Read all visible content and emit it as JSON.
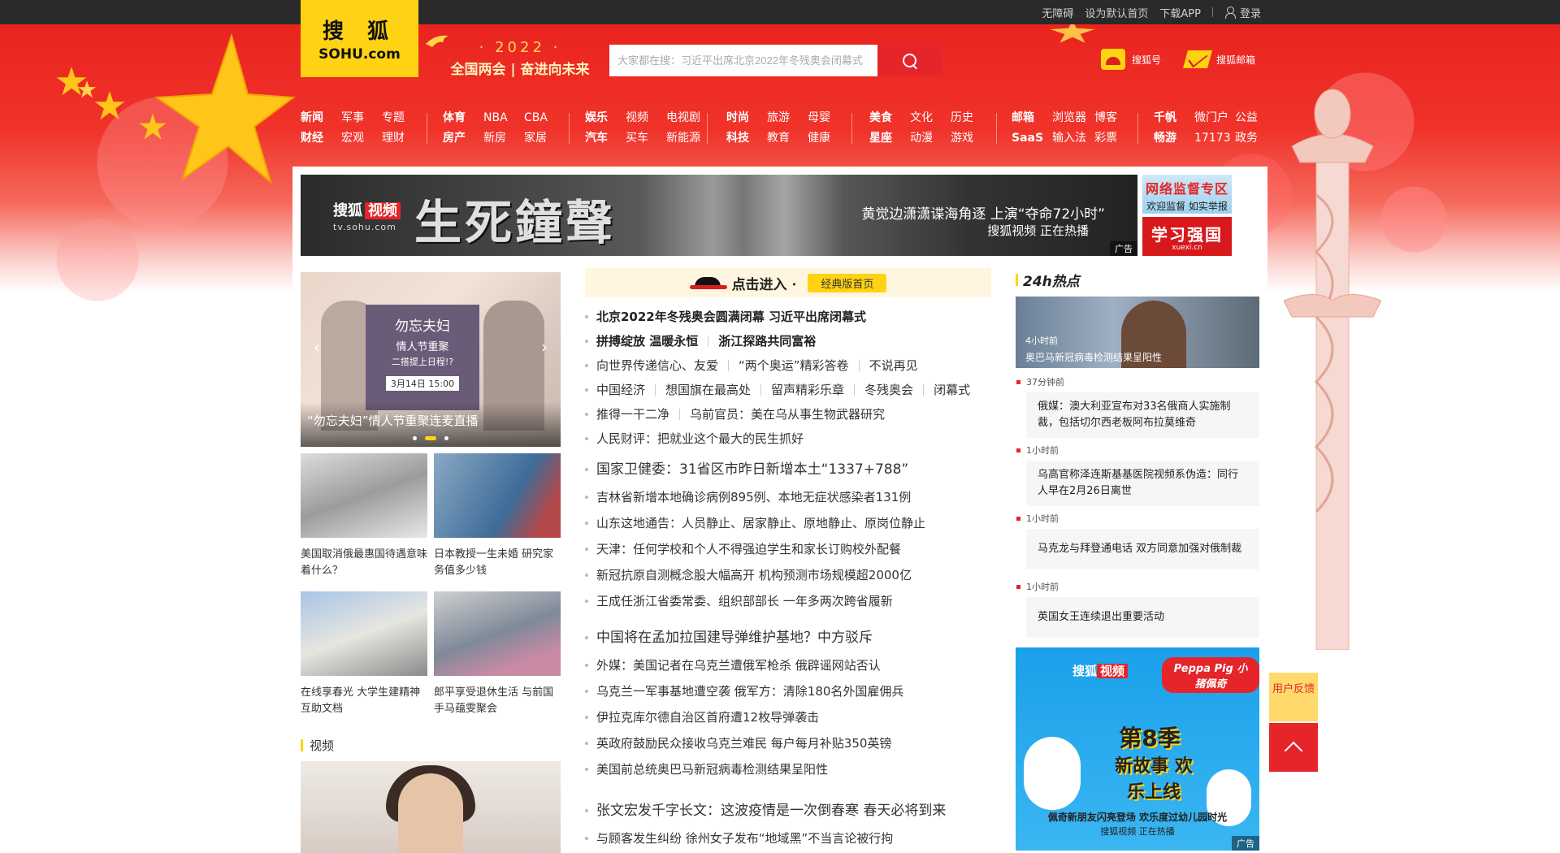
{
  "topbar": {
    "accessibility": "无障碍",
    "set_home": "设为默认首页",
    "download_app": "下载APP",
    "login": "登录"
  },
  "logo": {
    "cn": "搜 狐",
    "en": "SOHU.com"
  },
  "slogan": {
    "year": "· 2022 ·",
    "text": "全国两会 | 奋进向未来"
  },
  "search": {
    "placeholder": "大家都在搜：习近平出席北京2022年冬残奥会闭幕式"
  },
  "header_links": {
    "hao": "搜狐号",
    "mail": "搜狐邮箱"
  },
  "nav": [
    [
      "新闻",
      "军事",
      "专题",
      "财经",
      "宏观",
      "理财"
    ],
    [
      "体育",
      "NBA",
      "CBA",
      "房产",
      "新房",
      "家居"
    ],
    [
      "娱乐",
      "视频",
      "电视剧",
      "汽车",
      "买车",
      "新能源"
    ],
    [
      "时尚",
      "旅游",
      "母婴",
      "科技",
      "教育",
      "健康"
    ],
    [
      "美食",
      "文化",
      "历史",
      "星座",
      "动漫",
      "游戏"
    ],
    [
      "邮箱",
      "浏览器",
      "博客",
      "SaaS",
      "输入法",
      "彩票"
    ],
    [
      "千帆",
      "微门户",
      "公益",
      "畅游",
      "17173",
      "政务"
    ]
  ],
  "banner": {
    "brand_a": "搜狐",
    "brand_b": "视频",
    "url": "tv.sohu.com",
    "title": "生死鐘聲",
    "line1": "黄觉边潇潇谍海角逐  上演“夺命72小时”",
    "line2": "搜狐视频  正在热播",
    "ad": "广告"
  },
  "side_ads": {
    "a1_title": "网络监督专区",
    "a1_sub": "欢迎监督  如实举报",
    "a2_title": "学习强国",
    "a2_sub": "xuexi.cn"
  },
  "slider": {
    "poster_title": "勿忘夫妇",
    "poster_sub": "情人节重聚",
    "poster_line": "二搭提上日程!?",
    "poster_date": "3月14日 15:00",
    "caption": "“勿忘夫妇”情人节重聚连麦直播"
  },
  "pics": [
    {
      "caption": "美国取消俄最惠国待遇意味着什么？"
    },
    {
      "caption": "日本教授一生未婚 研究家务值多少钱"
    },
    {
      "caption": "在线享春光 大学生建精神互助文档"
    },
    {
      "caption": "郎平享受退休生活 与前国手马蕴雯聚会"
    }
  ],
  "video_section": {
    "title": "视频"
  },
  "classic": {
    "enter": "点击进入 ·",
    "button": "经典版首页"
  },
  "news_block1": {
    "row1": "北京2022年冬残奥会圆满闭幕 习近平出席闭幕式",
    "row2a": "拼搏绽放 温暖永恒",
    "row2b": "浙江探路共同富裕",
    "row3": [
      "向世界传递信心、友爱",
      "“两个奥运”精彩答卷",
      "不说再见"
    ],
    "row4": [
      "中国经济",
      "想国旗在最高处",
      "留声精彩乐章",
      "冬残奥会",
      "闭幕式"
    ],
    "row5": [
      "推得一干二净",
      "乌前官员：美在乌从事生物武器研究"
    ],
    "row6": "人民财评：把就业这个最大的民生抓好"
  },
  "news_block2": [
    "国家卫健委：31省区市昨日新增本土“1337+788”",
    "吉林省新增本地确诊病例895例、本地无症状感染者131例",
    "山东这地通告：人员静止、居家静止、原地静止、原岗位静止",
    "天津：任何学校和个人不得强迫学生和家长订购校外配餐",
    "新冠抗原自测概念股大幅高开 机构预测市场规模超2000亿",
    "王成任浙江省委常委、组织部部长 一年多两次跨省履新"
  ],
  "news_block3": [
    "中国将在孟加拉国建导弹维护基地？中方驳斥",
    "外媒：美国记者在乌克兰遭俄军枪杀 俄辟谣网站否认",
    "乌克兰一军事基地遭空袭 俄军方：清除180名外国雇佣兵",
    "伊拉克库尔德自治区首府遭12枚导弹袭击",
    "英政府鼓励民众接收乌克兰难民 每户每月补贴350英镑",
    "美国前总统奥巴马新冠病毒检测结果呈阳性"
  ],
  "news_block4": [
    "张文宏发千字长文：这波疫情是一次倒春寒 春天必将到来",
    "与顾客发生纠纷 徐州女子发布“地域黑”不当言论被行拘"
  ],
  "hot": {
    "title": "24h热点",
    "pic_time": "4小时前",
    "pic_text": "奥巴马新冠病毒检测结果呈阳性",
    "items": [
      {
        "time": "37分钟前",
        "text": "俄媒：澳大利亚宣布对33名俄商人实施制裁，包括切尔西老板阿布拉莫维奇"
      },
      {
        "time": "1小时前",
        "text": "乌高官称泽连斯基基医院视频系伪造：同行人早在2月26日离世"
      },
      {
        "time": "1小时前",
        "text": "马克龙与拜登通电话 双方同意加强对俄制裁"
      },
      {
        "time": "1小时前",
        "text": "英国女王连续退出重要活动"
      }
    ]
  },
  "peppa_ad": {
    "brand_a": "搜狐",
    "brand_b": "视频",
    "peppa": "Peppa Pig 小猪佩奇",
    "s1": "第8季",
    "s2": "新故事 欢乐上线",
    "s3": "佩奇新朋友闪亮登场 欢乐度过幼儿园时光",
    "s4": "搜狐视频  正在热播",
    "ad": "广告"
  },
  "float": {
    "feedback": "用户反馈"
  }
}
